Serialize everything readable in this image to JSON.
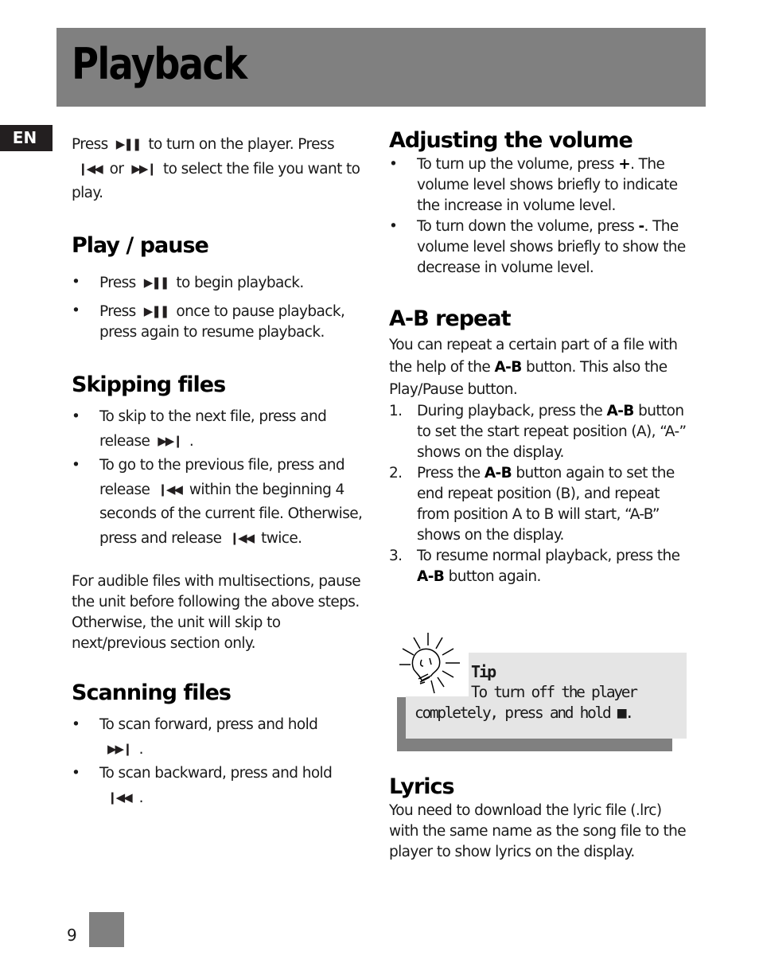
{
  "header": {
    "title": "Playback"
  },
  "language_tab": "EN",
  "icons": {
    "play_pause": "▶❚❚",
    "prev": "❙◀◀",
    "next": "▶▶❙",
    "stop": "■"
  },
  "intro": {
    "part1": "Press",
    "part2": "to turn on the player. Press",
    "part3": "or",
    "part4": "to select the file you want to play."
  },
  "play_pause": {
    "heading": "Play / pause",
    "items": [
      {
        "before": "Press",
        "after": "to begin playback."
      },
      {
        "before": "Press",
        "after": "once to pause playback, press again to resume playback."
      }
    ]
  },
  "skipping": {
    "heading": "Skipping files",
    "items": [
      {
        "before": "To skip to the next file, press and release",
        "after": "."
      },
      {
        "before": "To go to the previous file, press and release",
        "middle": "within the beginning 4 seconds of the current file. Otherwise, press and release",
        "after": "twice."
      }
    ],
    "note": "For audible files with multisections, pause the unit before following the above steps. Otherwise, the unit will skip to next/previous section only."
  },
  "scanning": {
    "heading": "Scanning files",
    "items": [
      {
        "before": "To scan forward, press and hold",
        "after": "."
      },
      {
        "before": "To scan backward, press and hold",
        "after": "."
      }
    ]
  },
  "volume": {
    "heading": "Adjusting the volume",
    "items": [
      {
        "before": "To turn up the volume, press",
        "key": "+",
        "after": ". The volume level shows briefly to indicate the increase in volume level."
      },
      {
        "before": "To turn down the volume, press",
        "key": "-",
        "after": ". The volume level shows briefly to show the decrease in volume level."
      }
    ]
  },
  "ab_repeat": {
    "heading": "A-B repeat",
    "intro_before": "You can repeat a certain part of a file with the help of the",
    "button": "A-B",
    "intro_after": "button. This also the Play/Pause button.",
    "steps": [
      {
        "num": "1.",
        "before": "During playback, press the",
        "after": "button  to set the start repeat position (A), “A-” shows on the display."
      },
      {
        "num": "2.",
        "before": "Press the",
        "after": "button again to set the end repeat position (B), and repeat from position A to B will start, “A-B” shows on the display."
      },
      {
        "num": "3.",
        "before": "To resume normal playback, press the",
        "after": "button again."
      }
    ]
  },
  "tip": {
    "title": "Tip",
    "text": "To turn off the player completely, press and hold",
    "end": "."
  },
  "lyrics": {
    "heading": "Lyrics",
    "text": "You  need to download the lyric file (.lrc) with the same name as the song file to the player to show lyrics on the display."
  },
  "footer": {
    "page_number": "9"
  }
}
